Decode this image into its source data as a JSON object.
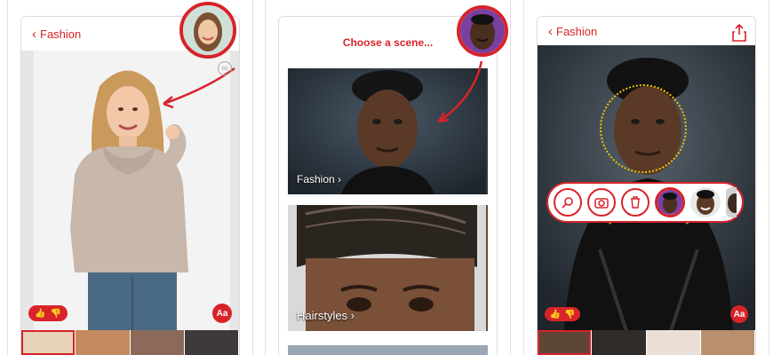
{
  "screen1": {
    "back_label": "Fashion",
    "cc_label": "cc",
    "font_button": "Aa"
  },
  "screen2": {
    "prompt": "Choose a scene...",
    "scenes": [
      {
        "label": "Fashion"
      },
      {
        "label": "Hairstyles"
      }
    ]
  },
  "screen3": {
    "back_label": "Fashion",
    "font_button": "Aa"
  },
  "colors": {
    "accent": "#d8232a",
    "face_guide": "#f2c200"
  },
  "icons": [
    "chevron-left-icon",
    "share-icon",
    "thumbs-up-icon",
    "thumbs-down-icon",
    "search-icon",
    "camera-icon",
    "trash-icon",
    "cc-icon"
  ]
}
